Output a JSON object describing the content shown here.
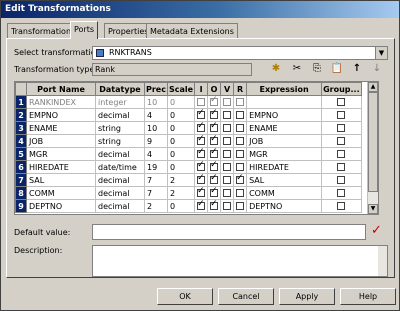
{
  "window": {
    "title": "Edit Transformations"
  },
  "tabs": [
    {
      "label": "Transformation"
    },
    {
      "label": "Ports"
    },
    {
      "label": "Properties"
    },
    {
      "label": "Metadata Extensions"
    }
  ],
  "select_transformation": {
    "label": "Select transformation:",
    "value": "RNKTRANS"
  },
  "transformation_type": {
    "label": "Transformation type:",
    "value": "Rank"
  },
  "toolbar_icons": [
    "new-port-icon",
    "cut-icon",
    "copy-icon",
    "paste-icon",
    "move-up-icon",
    "move-down-icon"
  ],
  "grid": {
    "headers": [
      "Port Name",
      "Datatype",
      "Prec",
      "Scale",
      "I",
      "O",
      "V",
      "R",
      "Expression",
      "Group..."
    ],
    "rows": [
      {
        "num": "1",
        "name": "RANKINDEX",
        "datatype": "integer",
        "prec": "10",
        "scale": "0",
        "I": false,
        "O": true,
        "V": false,
        "R": false,
        "expr": "",
        "group": false,
        "disabled": true
      },
      {
        "num": "2",
        "name": "EMPNO",
        "datatype": "decimal",
        "prec": "4",
        "scale": "0",
        "I": true,
        "O": true,
        "V": false,
        "R": false,
        "expr": "EMPNO",
        "group": false,
        "disabled": false
      },
      {
        "num": "3",
        "name": "ENAME",
        "datatype": "string",
        "prec": "10",
        "scale": "0",
        "I": true,
        "O": true,
        "V": false,
        "R": false,
        "expr": "ENAME",
        "group": false,
        "disabled": false
      },
      {
        "num": "4",
        "name": "JOB",
        "datatype": "string",
        "prec": "9",
        "scale": "0",
        "I": true,
        "O": true,
        "V": false,
        "R": false,
        "expr": "JOB",
        "group": false,
        "disabled": false
      },
      {
        "num": "5",
        "name": "MGR",
        "datatype": "decimal",
        "prec": "4",
        "scale": "0",
        "I": true,
        "O": true,
        "V": false,
        "R": false,
        "expr": "MGR",
        "group": false,
        "disabled": false
      },
      {
        "num": "6",
        "name": "HIREDATE",
        "datatype": "date/time",
        "prec": "19",
        "scale": "0",
        "I": true,
        "O": true,
        "V": false,
        "R": false,
        "expr": "HIREDATE",
        "group": false,
        "disabled": false
      },
      {
        "num": "7",
        "name": "SAL",
        "datatype": "decimal",
        "prec": "7",
        "scale": "2",
        "I": true,
        "O": true,
        "V": false,
        "R": true,
        "expr": "SAL",
        "group": false,
        "disabled": false
      },
      {
        "num": "8",
        "name": "COMM",
        "datatype": "decimal",
        "prec": "7",
        "scale": "2",
        "I": true,
        "O": true,
        "V": false,
        "R": false,
        "expr": "COMM",
        "group": false,
        "disabled": false
      },
      {
        "num": "9",
        "name": "DEPTNO",
        "datatype": "decimal",
        "prec": "2",
        "scale": "0",
        "I": true,
        "O": true,
        "V": false,
        "R": false,
        "expr": "DEPTNO",
        "group": false,
        "disabled": false
      }
    ]
  },
  "default_value": {
    "label": "Default value:",
    "value": ""
  },
  "description": {
    "label": "Description:",
    "value": ""
  },
  "buttons": {
    "ok": "OK",
    "cancel": "Cancel",
    "apply": "Apply",
    "help": "Help"
  }
}
